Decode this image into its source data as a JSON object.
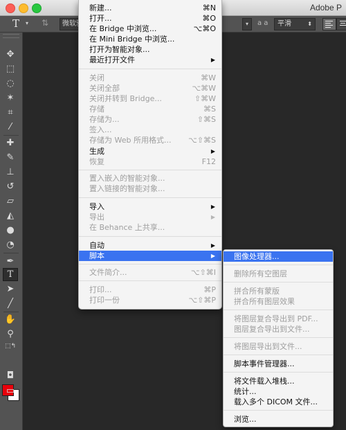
{
  "window": {
    "app_title": "Adobe P"
  },
  "options_bar": {
    "font_name": "微软雅黑",
    "antialias_icon_label": "a a",
    "antialias_value": "平滑",
    "tool_glyph": "T"
  },
  "tools": [
    {
      "name": "move-tool-icon",
      "glyph": "✥"
    },
    {
      "name": "marquee-tool-icon",
      "glyph": "⬚"
    },
    {
      "name": "lasso-tool-icon",
      "glyph": "◌"
    },
    {
      "name": "magic-wand-tool-icon",
      "glyph": "✶"
    },
    {
      "name": "crop-tool-icon",
      "glyph": "⌗"
    },
    {
      "name": "eyedropper-tool-icon",
      "glyph": "⁄"
    },
    {
      "name": "healing-brush-tool-icon",
      "glyph": "✚"
    },
    {
      "name": "brush-tool-icon",
      "glyph": "✎"
    },
    {
      "name": "clone-stamp-tool-icon",
      "glyph": "⊥"
    },
    {
      "name": "history-brush-tool-icon",
      "glyph": "↺"
    },
    {
      "name": "eraser-tool-icon",
      "glyph": "▱"
    },
    {
      "name": "paint-bucket-tool-icon",
      "glyph": "◭"
    },
    {
      "name": "blur-tool-icon",
      "glyph": "●"
    },
    {
      "name": "dodge-tool-icon",
      "glyph": "◔"
    },
    {
      "name": "pen-tool-icon",
      "glyph": "✒"
    },
    {
      "name": "type-tool-icon",
      "glyph": "T"
    },
    {
      "name": "path-selection-tool-icon",
      "glyph": "➤"
    },
    {
      "name": "line-tool-icon",
      "glyph": "╱"
    },
    {
      "name": "hand-tool-icon",
      "glyph": "✋"
    },
    {
      "name": "zoom-tool-icon",
      "glyph": "⚲"
    },
    {
      "name": "quick-mask-icon",
      "glyph": "◘"
    },
    {
      "name": "screen-mode-icon",
      "glyph": "▭"
    }
  ],
  "colors": {
    "foreground": "#e8000b",
    "background": "#ffffff",
    "highlight": "#3a73f0"
  },
  "file_menu": {
    "new": {
      "label": "新建...",
      "shortcut": "⌘N"
    },
    "open": {
      "label": "打开...",
      "shortcut": "⌘O"
    },
    "browse_bridge": {
      "label": "在 Bridge 中浏览...",
      "shortcut": "⌥⌘O"
    },
    "browse_mini_bridge": {
      "label": "在 Mini Bridge 中浏览..."
    },
    "open_smart_object": {
      "label": "打开为智能对象..."
    },
    "open_recent": {
      "label": "最近打开文件"
    },
    "close": {
      "label": "关闭",
      "shortcut": "⌘W"
    },
    "close_all": {
      "label": "关闭全部",
      "shortcut": "⌥⌘W"
    },
    "close_go_bridge": {
      "label": "关闭并转到 Bridge...",
      "shortcut": "⇧⌘W"
    },
    "save": {
      "label": "存储",
      "shortcut": "⌘S"
    },
    "save_as": {
      "label": "存储为...",
      "shortcut": "⇧⌘S"
    },
    "check_in": {
      "label": "签入..."
    },
    "save_for_web": {
      "label": "存储为 Web 所用格式...",
      "shortcut": "⌥⇧⌘S"
    },
    "generate": {
      "label": "生成"
    },
    "revert": {
      "label": "恢复",
      "shortcut": "F12"
    },
    "place_embedded": {
      "label": "置入嵌入的智能对象..."
    },
    "place_linked": {
      "label": "置入链接的智能对象..."
    },
    "import": {
      "label": "导入"
    },
    "export": {
      "label": "导出"
    },
    "share_behance": {
      "label": "在 Behance 上共享..."
    },
    "automate": {
      "label": "自动"
    },
    "scripts": {
      "label": "脚本"
    },
    "file_info": {
      "label": "文件简介...",
      "shortcut": "⌥⇧⌘I"
    },
    "print": {
      "label": "打印...",
      "shortcut": "⌘P"
    },
    "print_one": {
      "label": "打印一份",
      "shortcut": "⌥⇧⌘P"
    }
  },
  "scripts_submenu": {
    "image_processor": "图像处理器...",
    "delete_empty_layers": "删除所有空图层",
    "flatten_layer_comps": "拼合所有蒙版",
    "flatten_layer_effects": "拼合所有图层效果",
    "layer_comps_pdf": "将图层复合导出到 PDF...",
    "layer_comps_files": "图层复合导出到文件...",
    "export_layers_files": "将图层导出到文件...",
    "script_events_manager": "脚本事件管理器...",
    "load_files_stack": "将文件载入堆栈...",
    "statistics": "统计...",
    "load_dicom": "载入多个 DICOM 文件...",
    "browse": "浏览..."
  }
}
